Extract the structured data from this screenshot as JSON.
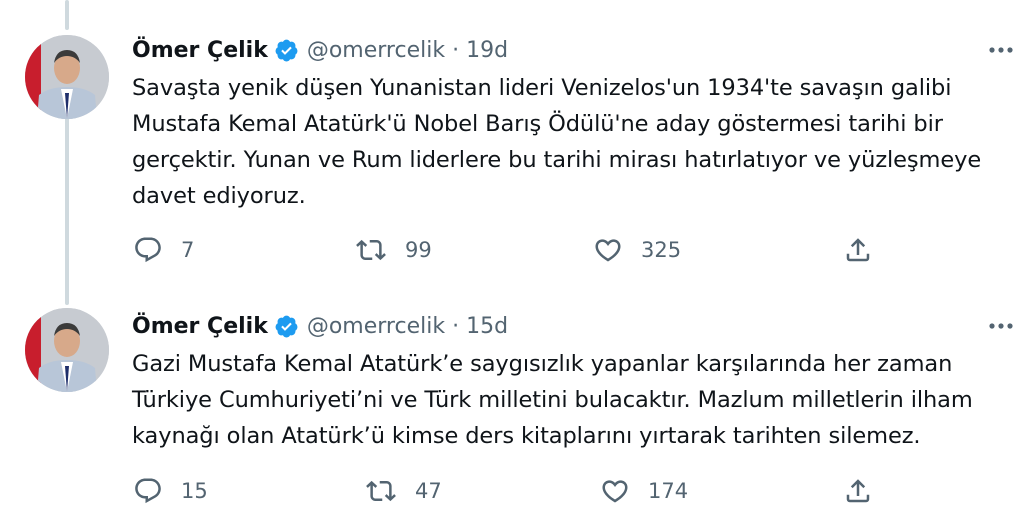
{
  "tweets": [
    {
      "author_name": "Ömer Çelik",
      "handle": "@omerrcelik",
      "separator": "·",
      "time": "19d",
      "text": "Savaşta yenik düşen Yunanistan lideri Venizelos'un 1934'te savaşın galibi\nMustafa Kemal Atatürk'ü Nobel Barış Ödülü'ne aday göstermesi tarihi bir\ngerçektir. Yunan ve Rum liderlere bu tarihi mirası hatırlatıyor ve yüzleşmeye\ndavet ediyoruz.",
      "replies": "7",
      "retweets": "99",
      "likes": "325"
    },
    {
      "author_name": "Ömer Çelik",
      "handle": "@omerrcelik",
      "separator": "·",
      "time": "15d",
      "text": "Gazi Mustafa Kemal Atatürk’e saygısızlık yapanlar karşılarında her zaman\nTürkiye Cumhuriyeti’ni ve Türk milletini bulacaktır. Mazlum milletlerin ilham\nkaynağı olan Atatürk’ü kimse ders kitaplarını yırtarak tarihten silemez.",
      "replies": "15",
      "retweets": "47",
      "likes": "174"
    }
  ],
  "icons": {
    "verified": "verified-badge-icon",
    "more": "more-icon",
    "reply": "reply-icon",
    "retweet": "retweet-icon",
    "like": "like-icon",
    "share": "share-icon"
  },
  "colors": {
    "verified_blue": "#1d9bf0",
    "secondary_text": "#536471",
    "thread_line": "#cfd9de"
  }
}
